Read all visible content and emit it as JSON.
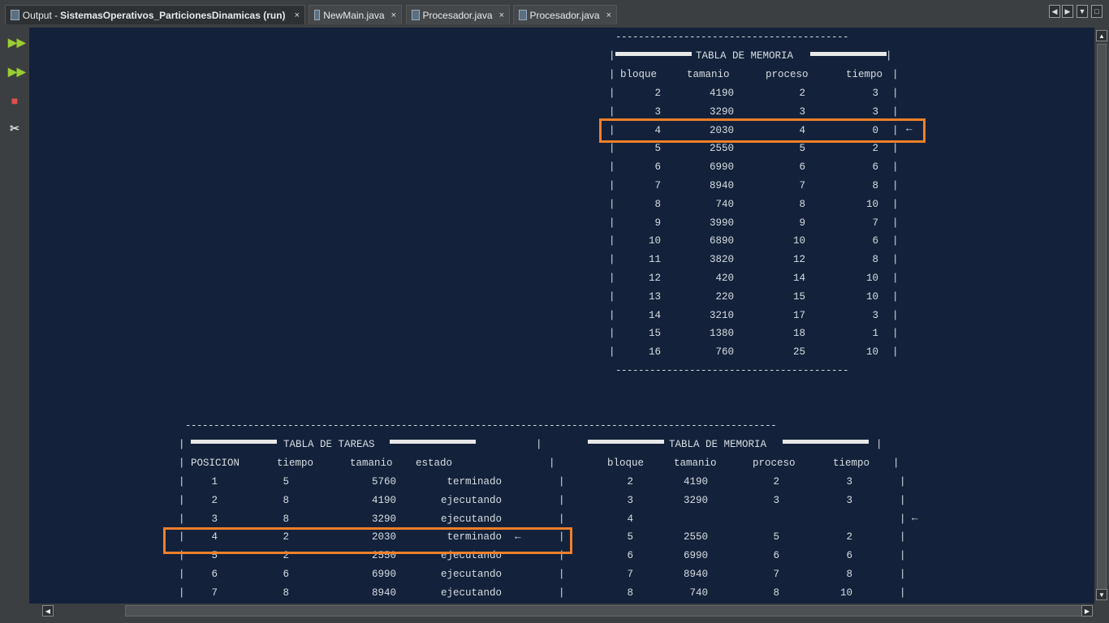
{
  "tabs": [
    {
      "label_prefix": "Output - ",
      "label_bold": "SistemasOperativos_ParticionesDinamicas (run)",
      "close": "×"
    },
    {
      "label": "NewMain.java",
      "close": "×"
    },
    {
      "label": "Procesador.java",
      "close": "×"
    },
    {
      "label": "Procesador.java",
      "close": "×"
    }
  ],
  "nav": {
    "left": "◀",
    "right": "▶",
    "down": "▼",
    "maximize": "□"
  },
  "sidebar": {
    "rerun": "▶▶",
    "rerun_alt": "▶▶",
    "stop": "■",
    "settings": "✂"
  },
  "dash_short": "-----------------------------------------",
  "dash_long": "--------------------------------------------------------------------------------------------------------",
  "memory_top": {
    "title": "TABLA DE MEMORIA",
    "headers": [
      "bloque",
      "tamanio",
      "proceso",
      "tiempo"
    ],
    "rows": [
      [
        "2",
        "4190",
        "2",
        "3"
      ],
      [
        "3",
        "3290",
        "3",
        "3"
      ],
      [
        "4",
        "2030",
        "4",
        "0"
      ],
      [
        "5",
        "2550",
        "5",
        "2"
      ],
      [
        "6",
        "6990",
        "6",
        "6"
      ],
      [
        "7",
        "8940",
        "7",
        "8"
      ],
      [
        "8",
        "740",
        "8",
        "10"
      ],
      [
        "9",
        "3990",
        "9",
        "7"
      ],
      [
        "10",
        "6890",
        "10",
        "6"
      ],
      [
        "11",
        "3820",
        "12",
        "8"
      ],
      [
        "12",
        "420",
        "14",
        "10"
      ],
      [
        "13",
        "220",
        "15",
        "10"
      ],
      [
        "14",
        "3210",
        "17",
        "3"
      ],
      [
        "15",
        "1380",
        "18",
        "1"
      ],
      [
        "16",
        "760",
        "25",
        "10"
      ]
    ],
    "arrow": "←"
  },
  "tasks": {
    "title": "TABLA DE TAREAS",
    "headers": [
      "POSICION",
      "tiempo",
      "tamanio",
      "estado"
    ],
    "rows": [
      [
        "1",
        "5",
        "5760",
        "terminado"
      ],
      [
        "2",
        "8",
        "4190",
        "ejecutando"
      ],
      [
        "3",
        "8",
        "3290",
        "ejecutando"
      ],
      [
        "4",
        "2",
        "2030",
        "terminado"
      ],
      [
        "5",
        "2",
        "2550",
        "ejecutando"
      ],
      [
        "6",
        "6",
        "6990",
        "ejecutando"
      ],
      [
        "7",
        "8",
        "8940",
        "ejecutando"
      ]
    ],
    "arrow": "←"
  },
  "memory_bottom": {
    "title": "TABLA DE MEMORIA",
    "headers": [
      "bloque",
      "tamanio",
      "proceso",
      "tiempo"
    ],
    "rows": [
      [
        "2",
        "4190",
        "2",
        "3"
      ],
      [
        "3",
        "3290",
        "3",
        "3"
      ],
      [
        "4",
        "",
        "",
        ""
      ],
      [
        "5",
        "2550",
        "5",
        "2"
      ],
      [
        "6",
        "6990",
        "6",
        "6"
      ],
      [
        "7",
        "8940",
        "7",
        "8"
      ],
      [
        "8",
        "740",
        "8",
        "10"
      ]
    ],
    "arrow": "←"
  },
  "pipe": "|"
}
